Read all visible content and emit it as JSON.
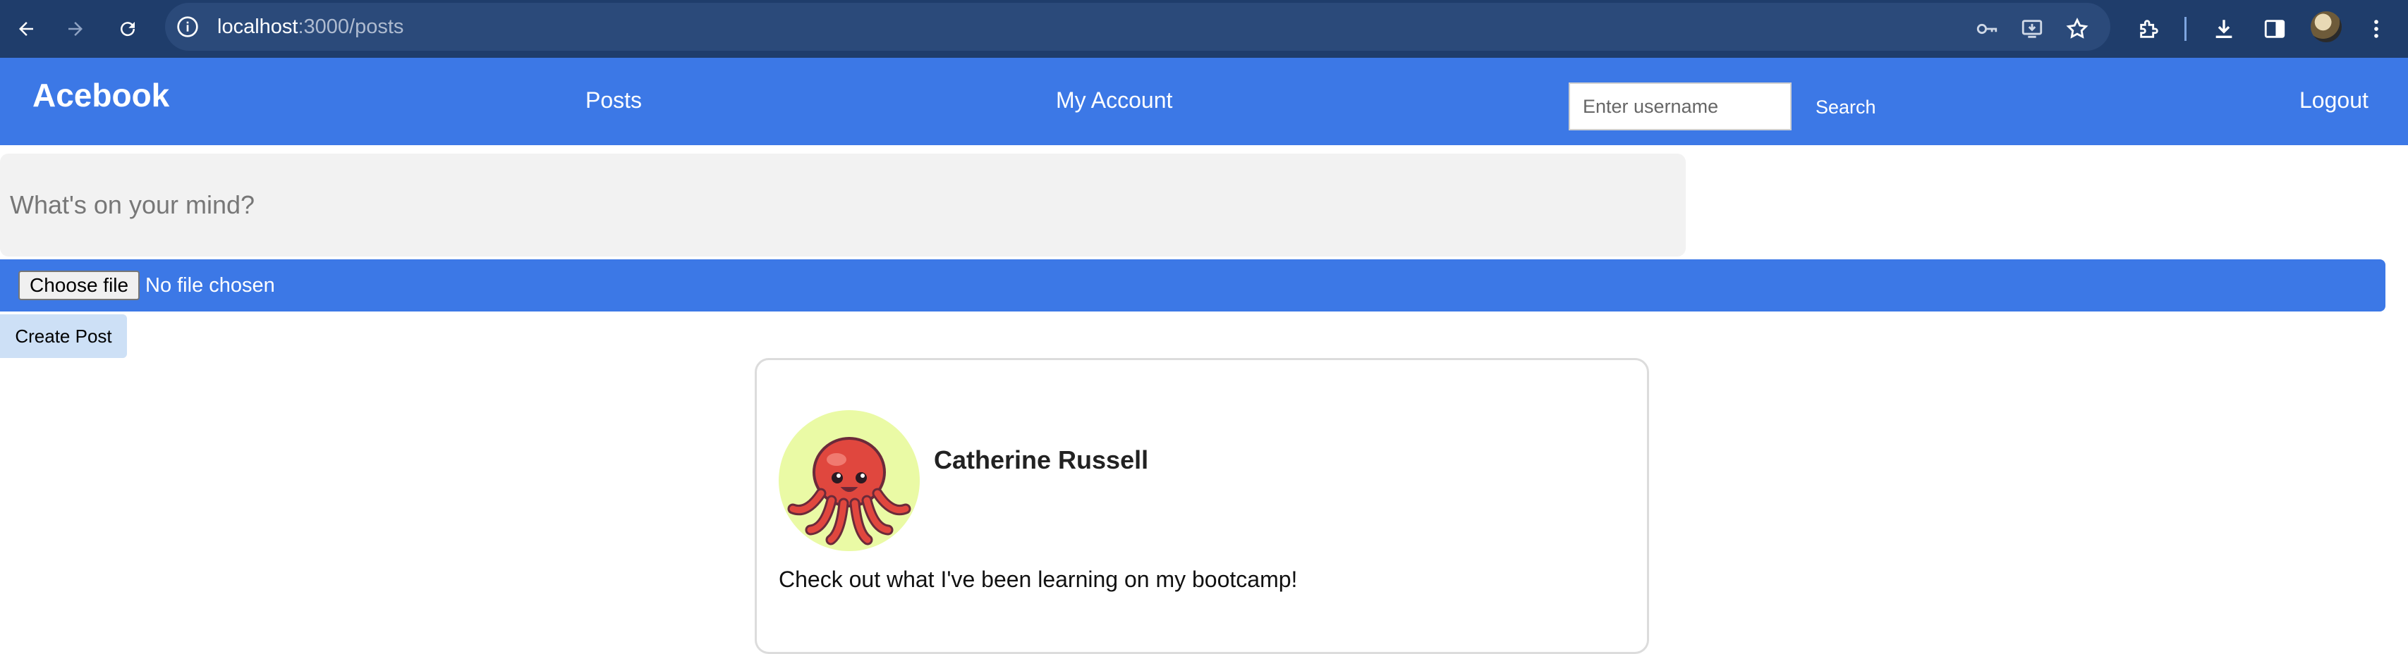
{
  "browser": {
    "url_host": "localhost",
    "url_path": ":3000/posts"
  },
  "navbar": {
    "brand": "Acebook",
    "posts_link": "Posts",
    "account_link": "My Account",
    "search_placeholder": "Enter username",
    "search_button": "Search",
    "logout_link": "Logout",
    "color": "#3c78e6"
  },
  "composer": {
    "placeholder": "What's on your mind?",
    "choose_file_label": "Choose file",
    "file_status": "No file chosen",
    "create_button": "Create Post"
  },
  "posts": [
    {
      "author": "Catherine Russell",
      "body": "Check out what I've been learning on my bootcamp!",
      "avatar_icon": "octopus-icon"
    }
  ]
}
